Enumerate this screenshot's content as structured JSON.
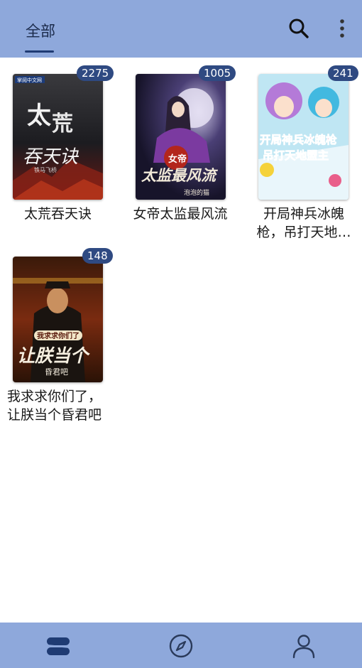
{
  "header": {
    "tab_label": "全部",
    "search_icon": "search-icon",
    "more_icon": "more-vert-icon"
  },
  "books": [
    {
      "title": "太荒吞天诀",
      "count": "2275",
      "cover_text": "太荒吞天诀",
      "cover_small": "掌阅中文网",
      "cover_author": "铁马飞桥"
    },
    {
      "title": "女帝太监最风流",
      "count": "1005",
      "cover_text": "太监最风流",
      "cover_top": "女帝",
      "cover_author": "泡泡的猫"
    },
    {
      "title": "开局神兵冰魄枪，吊打天地…",
      "title_line1": "开局神兵冰魄",
      "title_line2": "枪，吊打天地…",
      "count": "241",
      "cover_text": "开局神兵冰魄枪",
      "cover_text2": "吊打天地盟主"
    },
    {
      "title": "我求求你们了，让朕当个昏君吧",
      "title_line1": "我求求你们了，",
      "title_line2": "让朕当个昏君吧",
      "count": "148",
      "cover_top": "我求求你们了",
      "cover_text": "让朕当个",
      "cover_bottom": "昏君吧"
    }
  ],
  "bottom_nav": [
    {
      "name": "bookshelf",
      "icon": "stack-icon"
    },
    {
      "name": "discover",
      "icon": "compass-icon"
    },
    {
      "name": "profile",
      "icon": "person-icon"
    }
  ],
  "colors": {
    "bar": "#8ea8db",
    "badge": "#2f4a82",
    "accent": "#1f3b73"
  }
}
